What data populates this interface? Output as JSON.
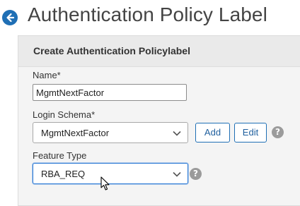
{
  "page": {
    "title": "Authentication Policy Label"
  },
  "panel": {
    "title": "Create Authentication Policylabel"
  },
  "form": {
    "name_label": "Name*",
    "name_value": "MgmtNextFactor",
    "schema_label": "Login Schema*",
    "schema_value": "MgmtNextFactor",
    "add_label": "Add",
    "edit_label": "Edit",
    "feature_label": "Feature Type",
    "feature_value": "RBA_REQ",
    "help_glyph": "?"
  },
  "colors": {
    "accent": "#1f6fb5",
    "focus": "#2e7bd6",
    "help": "#9b9b9b"
  },
  "icons": [
    "back-arrow-icon",
    "chevron-down-icon",
    "help-icon",
    "mouse-cursor-icon"
  ]
}
